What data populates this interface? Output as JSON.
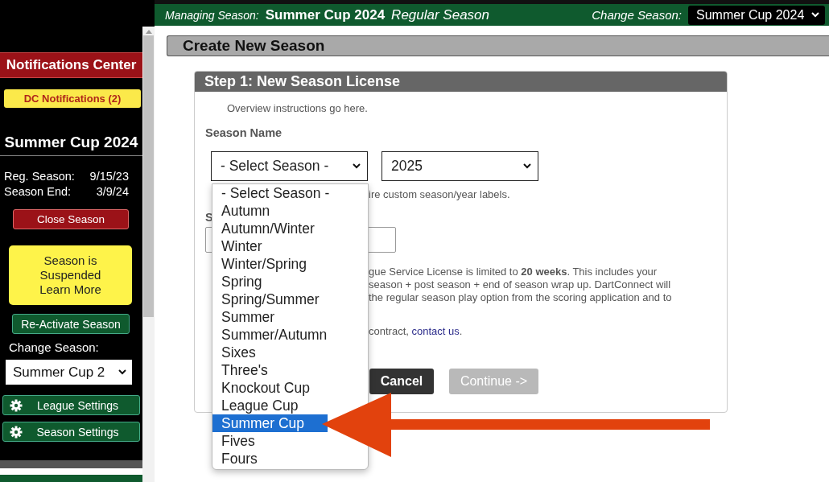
{
  "header": {
    "managing_label": "Managing Season:",
    "season": "Summer Cup 2024",
    "phase": "Regular Season",
    "change_label": "Change Season:",
    "change_value": "Summer Cup 2024"
  },
  "sidebar": {
    "notifications_title": "Notifications Center",
    "notifications_button": "DC Notifications (2)",
    "season_title": "Summer Cup 2024",
    "dates": [
      {
        "label": "Reg. Season:",
        "value": "9/15/23"
      },
      {
        "label": "Season End:",
        "value": "3/9/24"
      }
    ],
    "close_button": "Close Season",
    "suspended_lines": [
      "Season is",
      "Suspended"
    ],
    "learn_more": "Learn More",
    "reactivate_button": "Re-Activate Season",
    "change_label": "Change Season:",
    "change_value": "Summer Cup 2",
    "settings": [
      "League Settings",
      "Season Settings"
    ]
  },
  "page_title": "Create New Season",
  "step": {
    "title": "Step 1: New Season License",
    "overview": "Overview instructions go here.",
    "season_name_label": "Season Name",
    "season_select": "- Select Season -",
    "year_select": "2025",
    "hint": "ire custom season/year labels.",
    "label_2": "S",
    "notice_lines": [
      "gue Service License is limited to **20 weeks**. This includes your",
      "season + post season + end of season wrap up. DartConnect will",
      "the regular season play option from the scoring application and to"
    ],
    "contact": {
      "before": "contract,",
      "link": "contact us",
      "after": "."
    },
    "buttons": [
      {
        "label": "Cancel",
        "disabled": false
      },
      {
        "label": "Continue ->",
        "disabled": true
      }
    ]
  },
  "season_dropdown": {
    "options": [
      {
        "label": "- Select Season -",
        "selected": false
      },
      {
        "label": "Autumn",
        "selected": false
      },
      {
        "label": "Autumn/Winter",
        "selected": false
      },
      {
        "label": "Winter",
        "selected": false
      },
      {
        "label": "Winter/Spring",
        "selected": false
      },
      {
        "label": "Spring",
        "selected": false
      },
      {
        "label": "Spring/Summer",
        "selected": false
      },
      {
        "label": "Summer",
        "selected": false
      },
      {
        "label": "Summer/Autumn",
        "selected": false
      },
      {
        "label": "Sixes",
        "selected": false
      },
      {
        "label": "Three's",
        "selected": false
      },
      {
        "label": "Knockout Cup",
        "selected": false
      },
      {
        "label": "League Cup",
        "selected": false
      },
      {
        "label": "Summer Cup",
        "selected": true
      },
      {
        "label": "Fives",
        "selected": false
      },
      {
        "label": "Fours",
        "selected": false
      }
    ]
  }
}
